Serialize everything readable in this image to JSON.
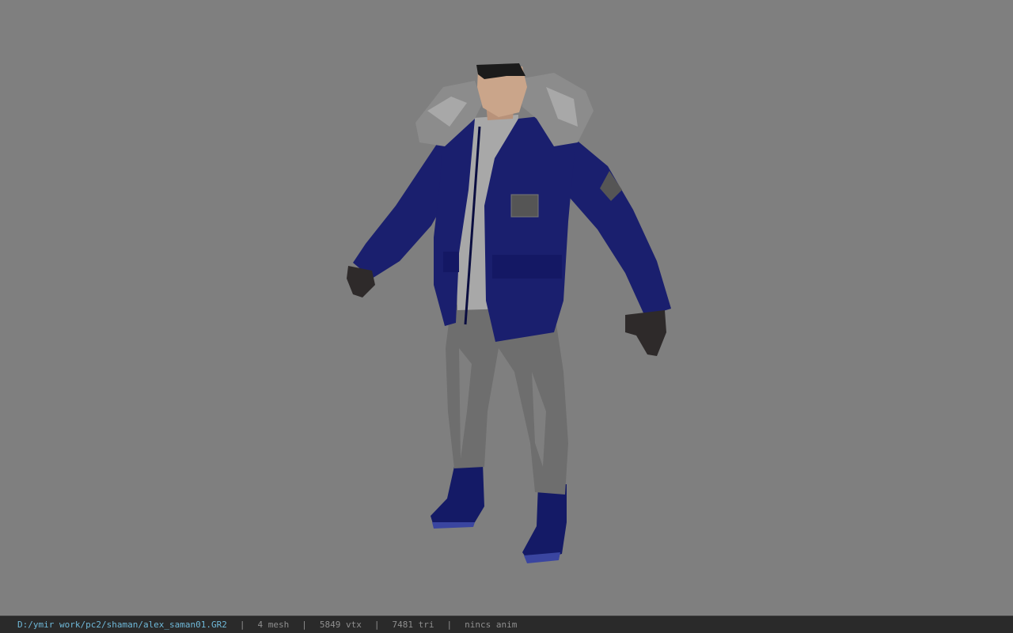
{
  "viewport": {
    "background_color": "#7f7f7f",
    "model": {
      "jacket_color": "#1a1f6e",
      "fur_color": "#8c8c8c",
      "pants_color": "#6e6e6e",
      "boots_color": "#141a66",
      "sweater_color": "#a8a8a8",
      "skin_color": "#caa58a",
      "hair_color": "#1b1b1b",
      "gloves_color": "#2e2a2a"
    }
  },
  "statusbar": {
    "file_path": "D:/ymir work/pc2/shaman/alex_saman01.GR2",
    "separator": "|",
    "mesh_count": "4 mesh",
    "vertex_count": "5849 vtx",
    "triangle_count": "7481 tri",
    "anim_status": "nincs anim",
    "path_color": "#6fb8d8",
    "text_color": "#8f8f8f",
    "bg_color": "#2a2a2a"
  }
}
